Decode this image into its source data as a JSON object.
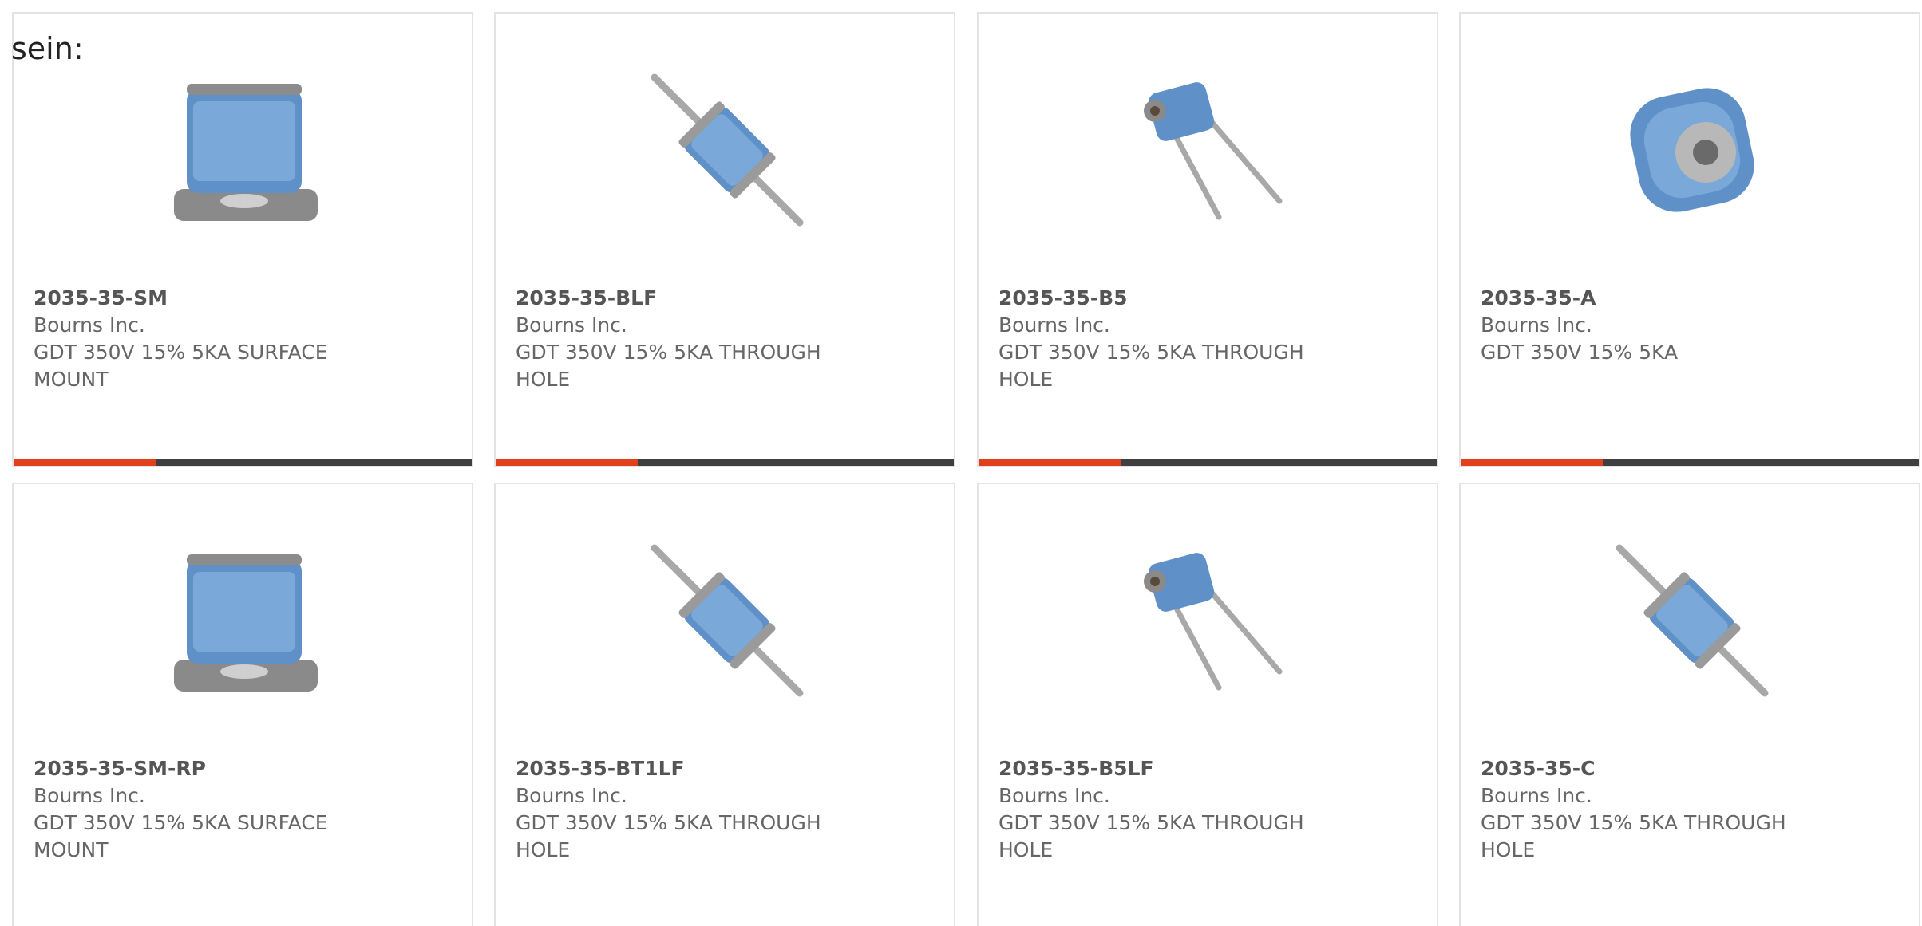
{
  "lead_text": "sein:",
  "colors": {
    "accent": "#e2401c",
    "bar_track": "#3f3f3f",
    "card_border": "#e3e3e3",
    "text": "#666666"
  },
  "products": [
    {
      "part_number": "2035-35-SM",
      "manufacturer": "Bourns Inc.",
      "description": "GDT 350V 15% 5KA SURFACE MOUNT",
      "image": "gdt-surface-mount-image",
      "progress": 0.31
    },
    {
      "part_number": "2035-35-BLF",
      "manufacturer": "Bourns Inc.",
      "description": "GDT 350V 15% 5KA THROUGH HOLE",
      "image": "gdt-axial-lead-image",
      "progress": 0.31
    },
    {
      "part_number": "2035-35-B5",
      "manufacturer": "Bourns Inc.",
      "description": "GDT 350V 15% 5KA THROUGH HOLE",
      "image": "gdt-radial-lead-image",
      "progress": 0.31
    },
    {
      "part_number": "2035-35-A",
      "manufacturer": "Bourns Inc.",
      "description": "GDT 350V 15% 5KA",
      "image": "gdt-barrel-image",
      "progress": 0.31
    },
    {
      "part_number": "2035-35-SM-RP",
      "manufacturer": "Bourns Inc.",
      "description": "GDT 350V 15% 5KA SURFACE MOUNT",
      "image": "gdt-surface-mount-image"
    },
    {
      "part_number": "2035-35-BT1LF",
      "manufacturer": "Bourns Inc.",
      "description": "GDT 350V 15% 5KA THROUGH HOLE",
      "image": "gdt-axial-lead-image"
    },
    {
      "part_number": "2035-35-B5LF",
      "manufacturer": "Bourns Inc.",
      "description": "GDT 350V 15% 5KA THROUGH HOLE",
      "image": "gdt-radial-lead-image"
    },
    {
      "part_number": "2035-35-C",
      "manufacturer": "Bourns Inc.",
      "description": "GDT 350V 15% 5KA THROUGH HOLE",
      "image": "gdt-axial-lead-image"
    }
  ]
}
